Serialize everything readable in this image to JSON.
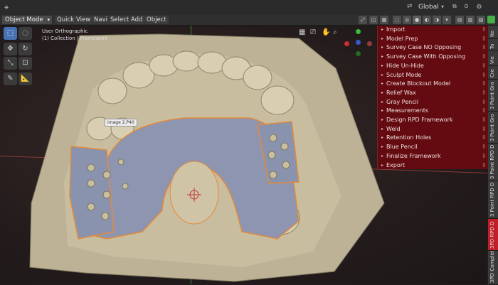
{
  "topbar": {
    "orientation": "Global",
    "icons": [
      "cursor-icon",
      "snap-icon",
      "proportional-icon"
    ]
  },
  "header": {
    "mode": "Object Mode",
    "menus": [
      "Quick",
      "View",
      "Navi",
      "Select",
      "Add",
      "Object"
    ]
  },
  "viewport": {
    "view_name": "User Orthographic",
    "collection": "(1) Collection | Framework",
    "tooltip": "Image 2.P40"
  },
  "npanel": {
    "items": [
      "Import",
      "Model Prep",
      "Survey Case NO Opposing",
      "Survey Case With Opposing",
      "Hide Un-Hide",
      "Sculpt Mode",
      "Create Blockout Model",
      "Relief Wax",
      "Gray Pencil",
      "Measurements",
      "Design RPD Framework",
      "Weld",
      "Retention Holes",
      "Blue Pencil",
      "Finalize Framework",
      "Export"
    ]
  },
  "sidetabs": [
    "Ite",
    "To",
    "Vie",
    "Cre",
    "3 Point Gra",
    "3 Point Gro",
    "3 Point RPD D",
    "3 Point RPD D",
    "3PD RPD D",
    "3PD Complete An"
  ],
  "colors": {
    "panel": "#630b10",
    "active_tab": "#c01e28",
    "tool_active": "#4772b3",
    "gingiva": "#8d95b0",
    "stone": "#bdb295",
    "outline": "#e48a3a"
  }
}
